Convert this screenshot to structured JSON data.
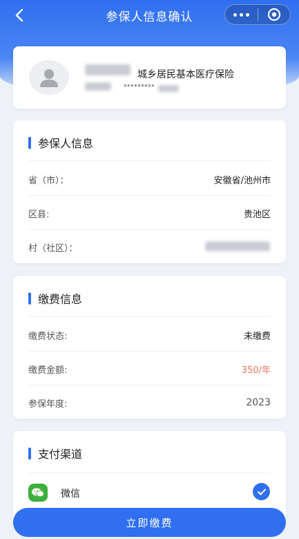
{
  "navbar": {
    "title": "参保人信息确认",
    "back_icon": "chevron-left-icon",
    "menu_icon": "more-dots-icon",
    "close_icon": "target-circle-icon"
  },
  "profile": {
    "insurance_name": "城乡居民基本医疗保险",
    "id_number_masked": "*********"
  },
  "insured_info": {
    "title": "参保人信息",
    "rows": [
      {
        "label": "省（市）：",
        "value": "安徽省/池州市"
      },
      {
        "label": "区县:",
        "value": "贵池区"
      },
      {
        "label": "村（社区）：",
        "value": ""
      }
    ]
  },
  "payment_info": {
    "title": "缴费信息",
    "rows": [
      {
        "label": "缴费状态:",
        "value": "未缴费"
      },
      {
        "label": "缴费金额:",
        "value": "350/年"
      },
      {
        "label": "参保年度:",
        "value": "2023"
      }
    ]
  },
  "payment_channel": {
    "title": "支付渠道",
    "option_label": "微信",
    "option_selected": true
  },
  "action": {
    "pay_label": "立即缴费"
  },
  "colors": {
    "primary": "#2f6ff0",
    "money": "#e8735a",
    "wechat": "#3cb03c"
  }
}
